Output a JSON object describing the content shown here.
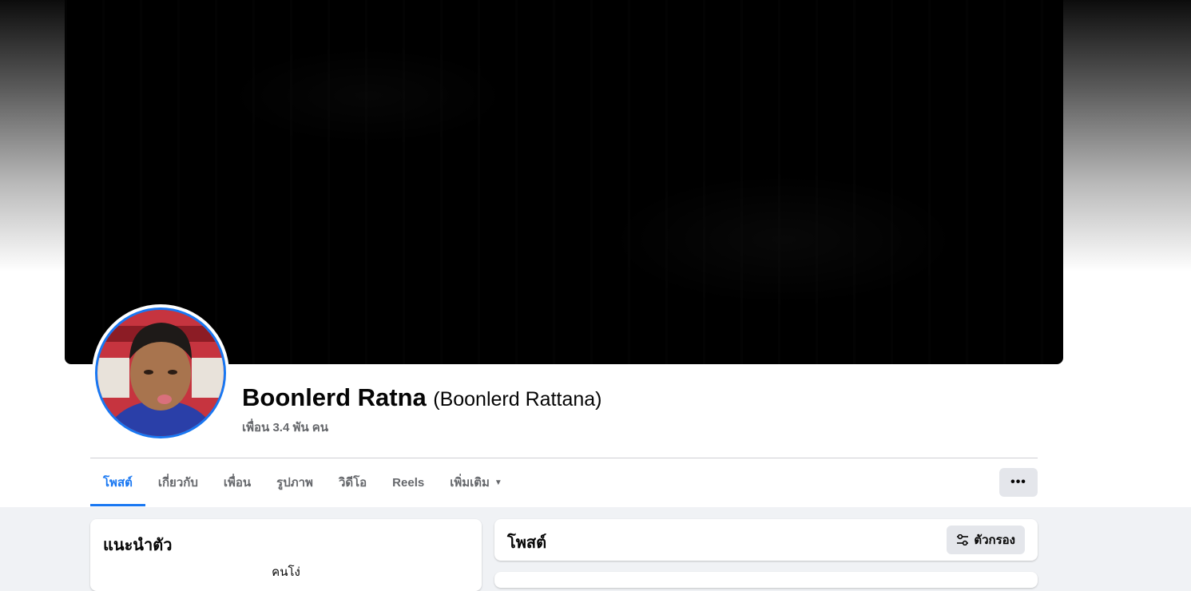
{
  "profile": {
    "name": "Boonlerd Ratna",
    "alternate_name": "(Boonlerd Rattana)",
    "friends_count": "เพื่อน 3.4 พัน คน"
  },
  "tabs": [
    {
      "label": "โพสต์",
      "active": true
    },
    {
      "label": "เกี่ยวกับ",
      "active": false
    },
    {
      "label": "เพื่อน",
      "active": false
    },
    {
      "label": "รูปภาพ",
      "active": false
    },
    {
      "label": "วิดีโอ",
      "active": false
    },
    {
      "label": "Reels",
      "active": false
    },
    {
      "label": "เพิ่มเติม",
      "active": false
    }
  ],
  "more_menu": {
    "label": "•••"
  },
  "intro": {
    "title": "แนะนำตัว",
    "bio": "คนโง่"
  },
  "posts": {
    "title": "โพสต์",
    "filter_label": "ตัวกรอง"
  },
  "colors": {
    "accent": "#1877f2",
    "page_bg": "#f0f2f5",
    "button_bg": "#e4e6eb",
    "secondary_text": "#65676b"
  },
  "icons": {
    "tab_more_caret": "caret-down-icon",
    "filter": "sliders-icon",
    "more_menu": "ellipsis-icon"
  }
}
